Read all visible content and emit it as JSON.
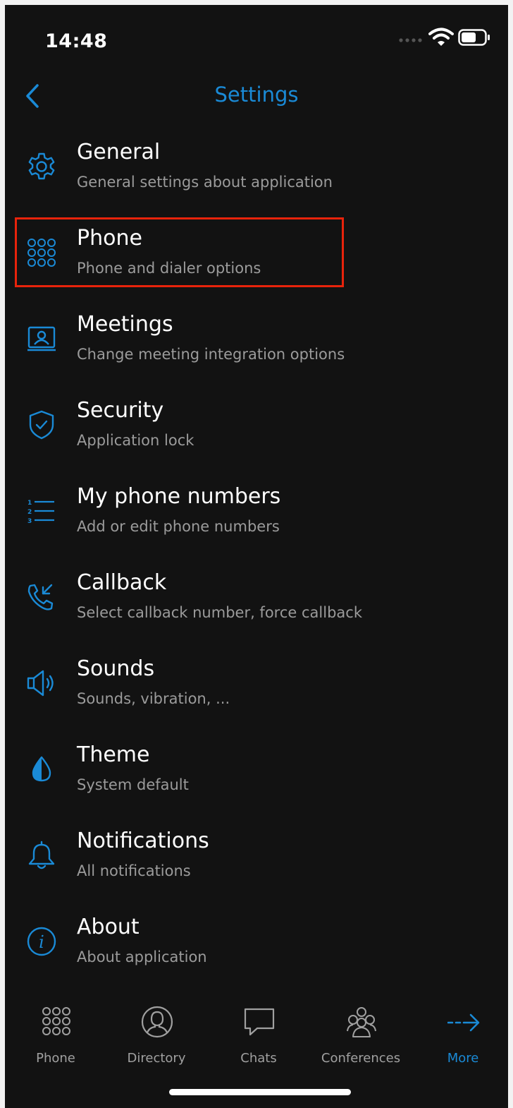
{
  "status": {
    "time": "14:48"
  },
  "nav": {
    "title": "Settings"
  },
  "items": [
    {
      "label": "General",
      "sub": "General settings about application",
      "icon": "gear-icon"
    },
    {
      "label": "Phone",
      "sub": "Phone and dialer options",
      "icon": "dialpad-icon"
    },
    {
      "label": "Meetings",
      "sub": "Change meeting integration options",
      "icon": "meeting-icon"
    },
    {
      "label": "Security",
      "sub": "Application lock",
      "icon": "shield-icon"
    },
    {
      "label": "My phone numbers",
      "sub": "Add or edit phone numbers",
      "icon": "numbered-list-icon"
    },
    {
      "label": "Callback",
      "sub": "Select callback number, force callback",
      "icon": "callback-icon"
    },
    {
      "label": "Sounds",
      "sub": "Sounds, vibration, ...",
      "icon": "speaker-icon"
    },
    {
      "label": "Theme",
      "sub": "System default",
      "icon": "theme-icon"
    },
    {
      "label": "Notifications",
      "sub": "All notifications",
      "icon": "bell-icon"
    },
    {
      "label": "About",
      "sub": "About application",
      "icon": "info-icon"
    }
  ],
  "tabs": [
    {
      "label": "Phone",
      "icon": "dialpad-icon"
    },
    {
      "label": "Directory",
      "icon": "person-icon"
    },
    {
      "label": "Chats",
      "icon": "chat-bubble-icon"
    },
    {
      "label": "Conferences",
      "icon": "group-icon"
    },
    {
      "label": "More",
      "icon": "arrow-right-icon",
      "active": true
    }
  ],
  "colors": {
    "accent": "#1a8ad6",
    "background": "#121212",
    "highlight": "#e8230b"
  }
}
